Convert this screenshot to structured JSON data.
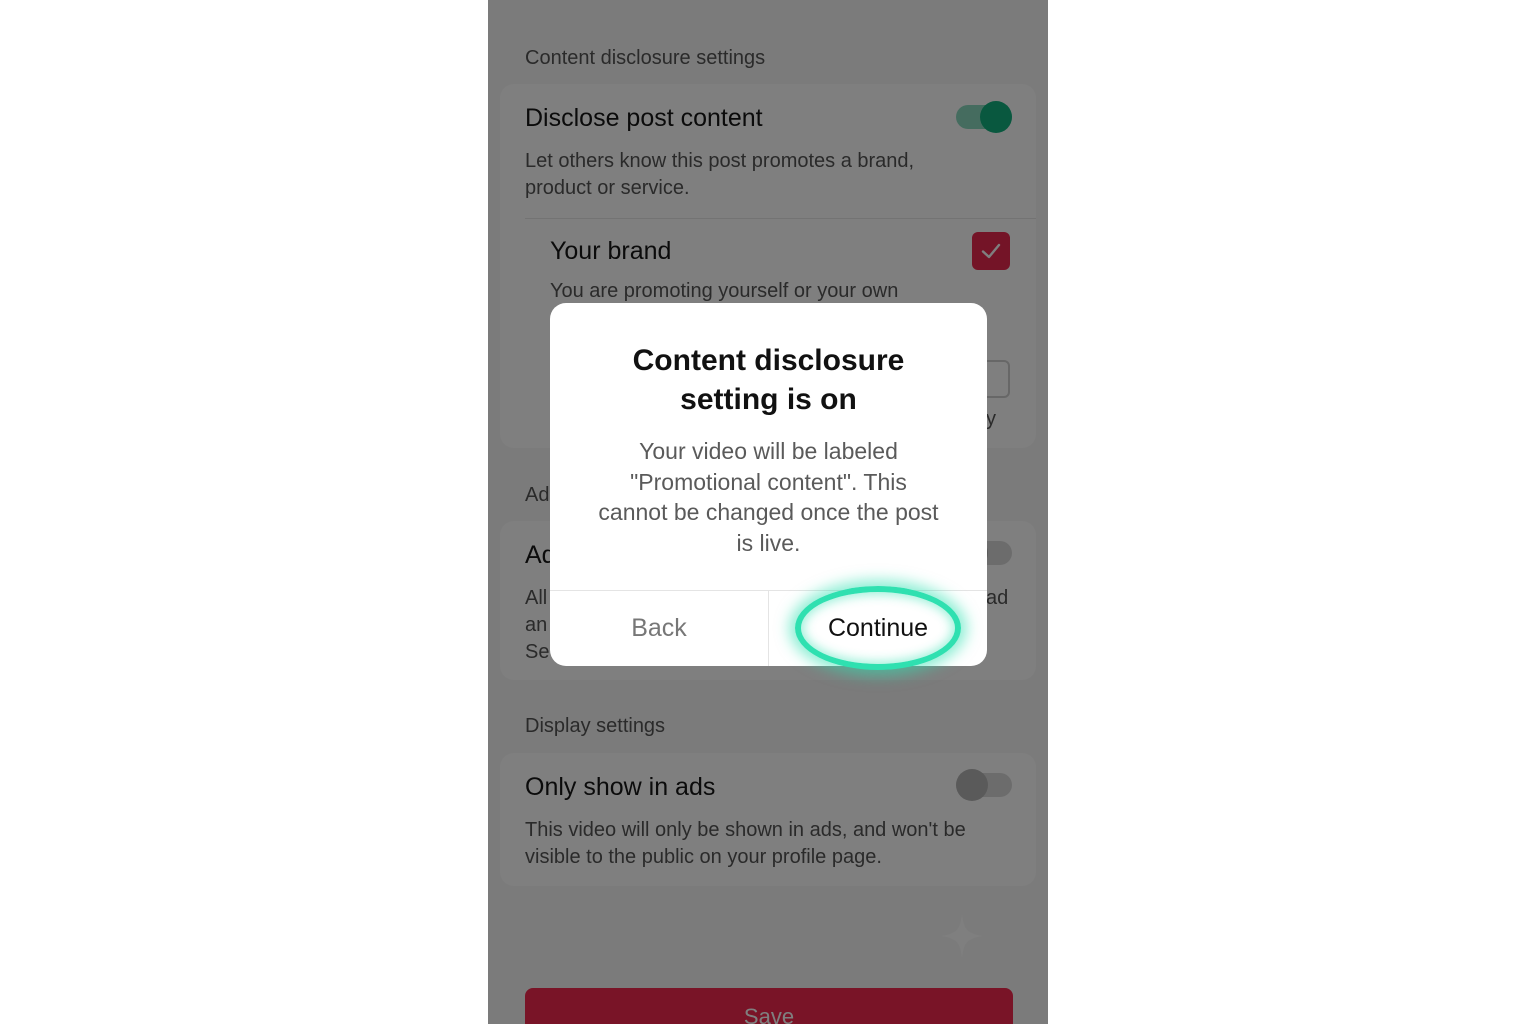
{
  "content_disclosure": {
    "section_label": "Content disclosure settings",
    "title": "Disclose post content",
    "description_line1": "Let others know this post promotes a brand,",
    "description_line2": "product or service.",
    "toggle_on": true,
    "your_brand": {
      "title": "Your brand",
      "description_line1": "You are promoting yourself or your own",
      "checked": true
    },
    "branded_content": {
      "partial_right_text": "y",
      "checked": false
    }
  },
  "ads_section": {
    "section_label_partial": "Ad",
    "title_partial": "Ad",
    "desc_line1_partial": "All",
    "desc_line1_right_partial": "ad",
    "desc_line2_partial": "an",
    "desc_line3_partial": "Se",
    "toggle_on": false
  },
  "display_settings": {
    "section_label": "Display settings",
    "title": "Only show in ads",
    "description_line1": "This video will only be shown in ads, and won't be",
    "description_line2": "visible to the public on your profile page.",
    "toggle_on": false
  },
  "save_button": {
    "label": "Save"
  },
  "dialog": {
    "title_line1": "Content disclosure",
    "title_line2": "setting is on",
    "body_line1": "Your video will be labeled",
    "body_line2": "\"Promotional content\". This",
    "body_line3": "cannot be changed once the post",
    "body_line4": "is live.",
    "back_label": "Back",
    "continue_label": "Continue"
  },
  "colors": {
    "accent_green": "#13b07e",
    "highlight_ring": "#2fe0b0",
    "brand_red": "#f2294e",
    "checkbox_red": "#e8294f"
  },
  "icons": [
    "check-icon",
    "sparkle-icon"
  ]
}
